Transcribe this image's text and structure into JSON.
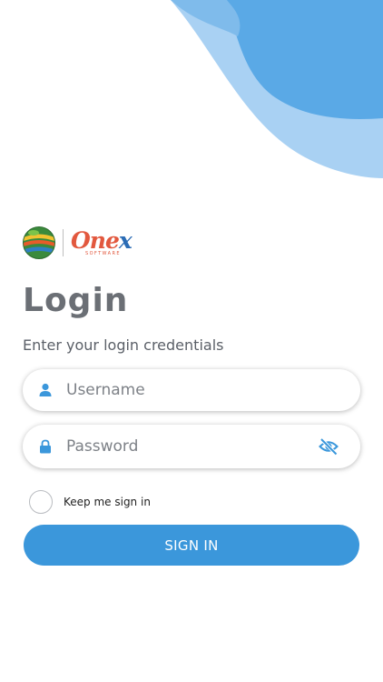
{
  "logo": {
    "brand_main": "One",
    "brand_x": "x",
    "brand_sub": "SOFTWARE"
  },
  "login": {
    "title": "Login",
    "subtitle": "Enter your login credentials"
  },
  "username_field": {
    "value": "",
    "placeholder": "Username",
    "icon": "person-icon"
  },
  "password_field": {
    "value": "",
    "placeholder": "Password",
    "icon": "lock-icon",
    "toggle_icon": "eye-slash-icon"
  },
  "remember": {
    "label": "Keep me sign in",
    "checked": false
  },
  "signin_button": {
    "label": "SIGN IN"
  },
  "colors": {
    "primary": "#3b97db",
    "blob_light": "#a9d1f3",
    "blob_dark": "#5aa9e6",
    "title_gray": "#6b6f75",
    "brand_orange": "#e2583e",
    "brand_blue": "#2b6cb5"
  }
}
